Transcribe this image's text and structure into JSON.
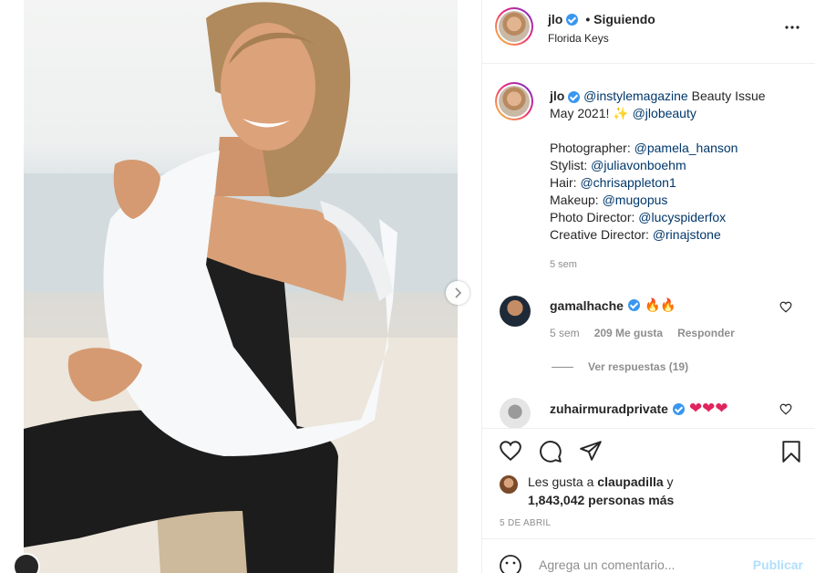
{
  "post": {
    "username": "jlo",
    "follow_status": "• Siguiendo",
    "location": "Florida Keys",
    "caption": {
      "line1_mention": "@instylemagazine",
      "line1_text": " Beauty Issue",
      "line2_text": "May 2021! ✨ ",
      "line2_mention": "@jlobeauty",
      "credits": [
        {
          "role": "Photographer: ",
          "handle": "@pamela_hanson"
        },
        {
          "role": "Stylist: ",
          "handle": "@juliavonboehm"
        },
        {
          "role": "Hair: ",
          "handle": "@chrisappleton1"
        },
        {
          "role": "Makeup: ",
          "handle": "@mugopus"
        },
        {
          "role": "Photo Director: ",
          "handle": "@lucyspiderfox"
        },
        {
          "role": "Creative Director: ",
          "handle": "@rinajstone"
        }
      ],
      "age": "5 sem"
    },
    "comments": [
      {
        "username": "gamalhache",
        "text": "🔥🔥",
        "age": "5 sem",
        "likes": "209 Me gusta",
        "reply": "Responder"
      },
      {
        "username": "zuhairmuradprivate",
        "text": "❤❤❤"
      }
    ],
    "view_replies": "Ver respuestas (19)",
    "likes": {
      "prefix": "Les gusta a ",
      "first_user": "claupadilla",
      "connector": " y",
      "others": "1,843,042 personas más"
    },
    "date": "5 DE ABRIL",
    "comment_placeholder": "Agrega un comentario...",
    "publish_label": "Publicar"
  },
  "icons": {
    "more": "more-horizontal-icon",
    "like": "heart-outline-icon",
    "comment": "comment-bubble-icon",
    "share": "paper-plane-icon",
    "save": "bookmark-icon",
    "emoji": "smiley-icon",
    "next": "chevron-right-icon",
    "verified": "verified-badge-icon"
  },
  "colors": {
    "link": "#00376b",
    "verified": "#3897f0",
    "muted": "#8e8e8e",
    "publish_disabled": "#b2dffc"
  }
}
